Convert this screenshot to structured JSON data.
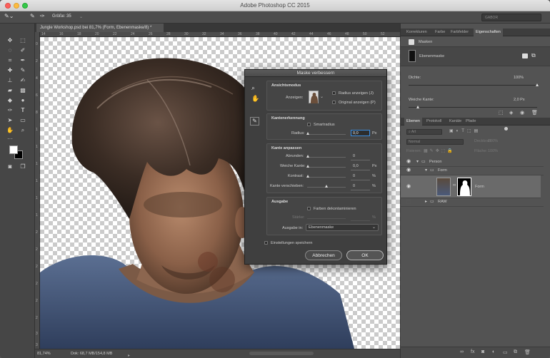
{
  "window": {
    "title": "Adobe Photoshop CC 2015"
  },
  "options_bar": {
    "size_label": "Größe:",
    "size_value": "35",
    "search_placeholder": "GABOR"
  },
  "document": {
    "tab_label": "Jungle Workshop.psd bei 81,7% (Form, Ebenenmaske/8) *"
  },
  "rulers": {
    "h": [
      "14",
      "16",
      "18",
      "20",
      "22",
      "24",
      "26",
      "28",
      "30",
      "32",
      "34",
      "36",
      "38",
      "40",
      "42",
      "44",
      "46",
      "48",
      "50",
      "52"
    ],
    "v": [
      "0",
      "2",
      "4",
      "6",
      "8",
      "1",
      "1",
      "1",
      "1",
      "1",
      "1",
      "2",
      "2",
      "2",
      "2",
      "2",
      "2",
      "3",
      "3"
    ]
  },
  "status": {
    "zoom": "81,74%",
    "doc": "Dok: 68,7 MB/154,8 MB"
  },
  "properties_panel": {
    "tabs": [
      "Korrekturen",
      "Farbe",
      "Farbfelder",
      "Eigenschaften"
    ],
    "active_tab": "Eigenschaften",
    "header": "Masken",
    "mask_type": "Ebenenmaske",
    "density_label": "Dichte:",
    "density_value": "100%",
    "feather_label": "Weiche Kante:",
    "feather_value": "2,0 Px",
    "density_fraction": 1.0,
    "feather_fraction": 0.07
  },
  "layers_panel": {
    "tabs": [
      "Ebenen",
      "Protokoll",
      "Kanäle",
      "Pfade"
    ],
    "active_tab": "Ebenen",
    "filter_label": "Art",
    "blend_mode": "Normal",
    "opacity_label": "Deckkraft:",
    "opacity_value": "100%",
    "lock_label": "Fixieren:",
    "fill_label": "Fläche:",
    "fill_value": "100%",
    "layers": [
      {
        "name": "Person"
      },
      {
        "name": "Form"
      },
      {
        "name": "Form"
      },
      {
        "name": "RAW"
      }
    ]
  },
  "dialog": {
    "title": "Maske verbessern",
    "view_mode": {
      "title": "Ansichtsmodus",
      "show_label": "Anzeigen:",
      "show_radius": "Radius anzeigen (J)",
      "show_original": "Original anzeigen (P)"
    },
    "edge_detection": {
      "title": "Kantenerkennung",
      "smart_radius": "Smartradius",
      "radius_label": "Radius:",
      "radius_value": "0,0",
      "unit": "Px"
    },
    "adjust_edge": {
      "title": "Kante anpassen",
      "rows": [
        {
          "label": "Abrunden:",
          "value": "0",
          "unit": ""
        },
        {
          "label": "Weiche Kante:",
          "value": "0,0",
          "unit": "Px"
        },
        {
          "label": "Kontrast:",
          "value": "0",
          "unit": "%"
        },
        {
          "label": "Kante verschieben:",
          "value": "0",
          "unit": "%"
        }
      ]
    },
    "output": {
      "title": "Ausgabe",
      "decontaminate": "Farben dekontaminieren",
      "strength_label": "Stärke:",
      "strength_unit": "%",
      "output_to_label": "Ausgabe in:",
      "output_to_value": "Ebenenmaske"
    },
    "remember": "Einstellungen speichern",
    "cancel": "Abbrechen",
    "ok": "OK"
  },
  "colors": {
    "accent": "#3d8ee0",
    "panel_bg": "#535353",
    "dialog_bg": "#3f3f3f"
  }
}
